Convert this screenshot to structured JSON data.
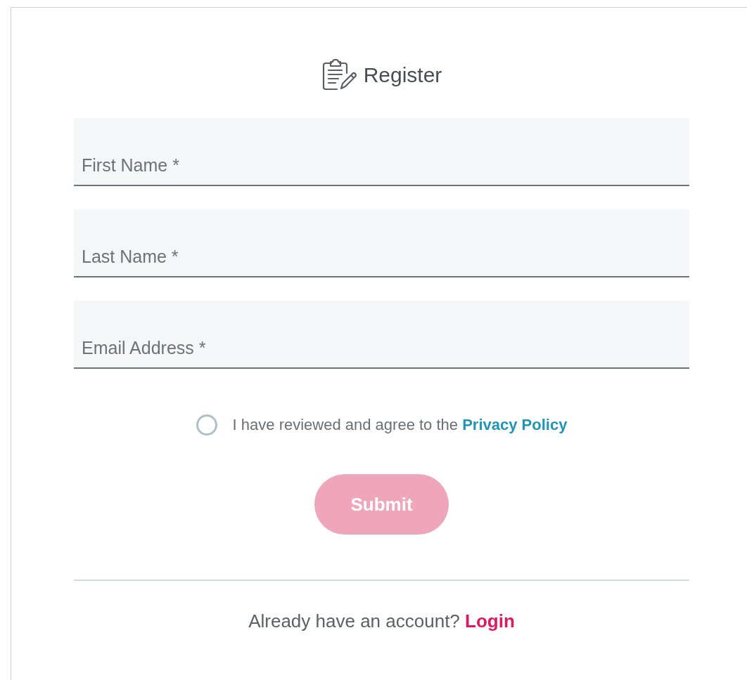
{
  "title": "Register",
  "fields": [
    {
      "placeholder": "First Name *"
    },
    {
      "placeholder": "Last Name *"
    },
    {
      "placeholder": "Email Address *"
    }
  ],
  "consent": {
    "checked": false,
    "text": "I have reviewed and agree to the",
    "link": "Privacy Policy"
  },
  "submit": {
    "label": "Submit",
    "disabled": true
  },
  "footer": {
    "text": "Already have an account?",
    "link": "Login"
  }
}
